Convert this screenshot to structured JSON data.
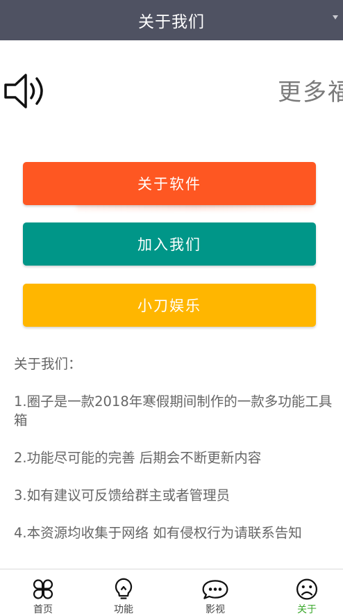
{
  "titlebar": {
    "title": "关于我们"
  },
  "announcement": {
    "marquee_text": "更多福利"
  },
  "buttons": {
    "about_software": "关于软件",
    "join_us": "加入我们",
    "entertainment": "小刀娱乐"
  },
  "about": {
    "heading": "关于我们：",
    "items": [
      "1.圈子是一款2018年寒假期间制作的一款多功能工具箱",
      "2.功能尽可能的完善 后期会不断更新内容",
      "3.如有建议可反馈给群主或者管理员",
      "4.本资源均收集于网络 如有侵权行为请联系告知"
    ]
  },
  "tabs": [
    {
      "label": "首页",
      "icon": "clover-icon",
      "active": false
    },
    {
      "label": "功能",
      "icon": "lightbulb-icon",
      "active": false
    },
    {
      "label": "影视",
      "icon": "chat-bubble-icon",
      "active": false
    },
    {
      "label": "关于",
      "icon": "sad-face-icon",
      "active": true
    }
  ],
  "colors": {
    "titlebar": "#4f5262",
    "btn_about": "#fe5722",
    "btn_join": "#009688",
    "btn_entertainment": "#ffb600",
    "tab_active": "#3aa82b"
  }
}
